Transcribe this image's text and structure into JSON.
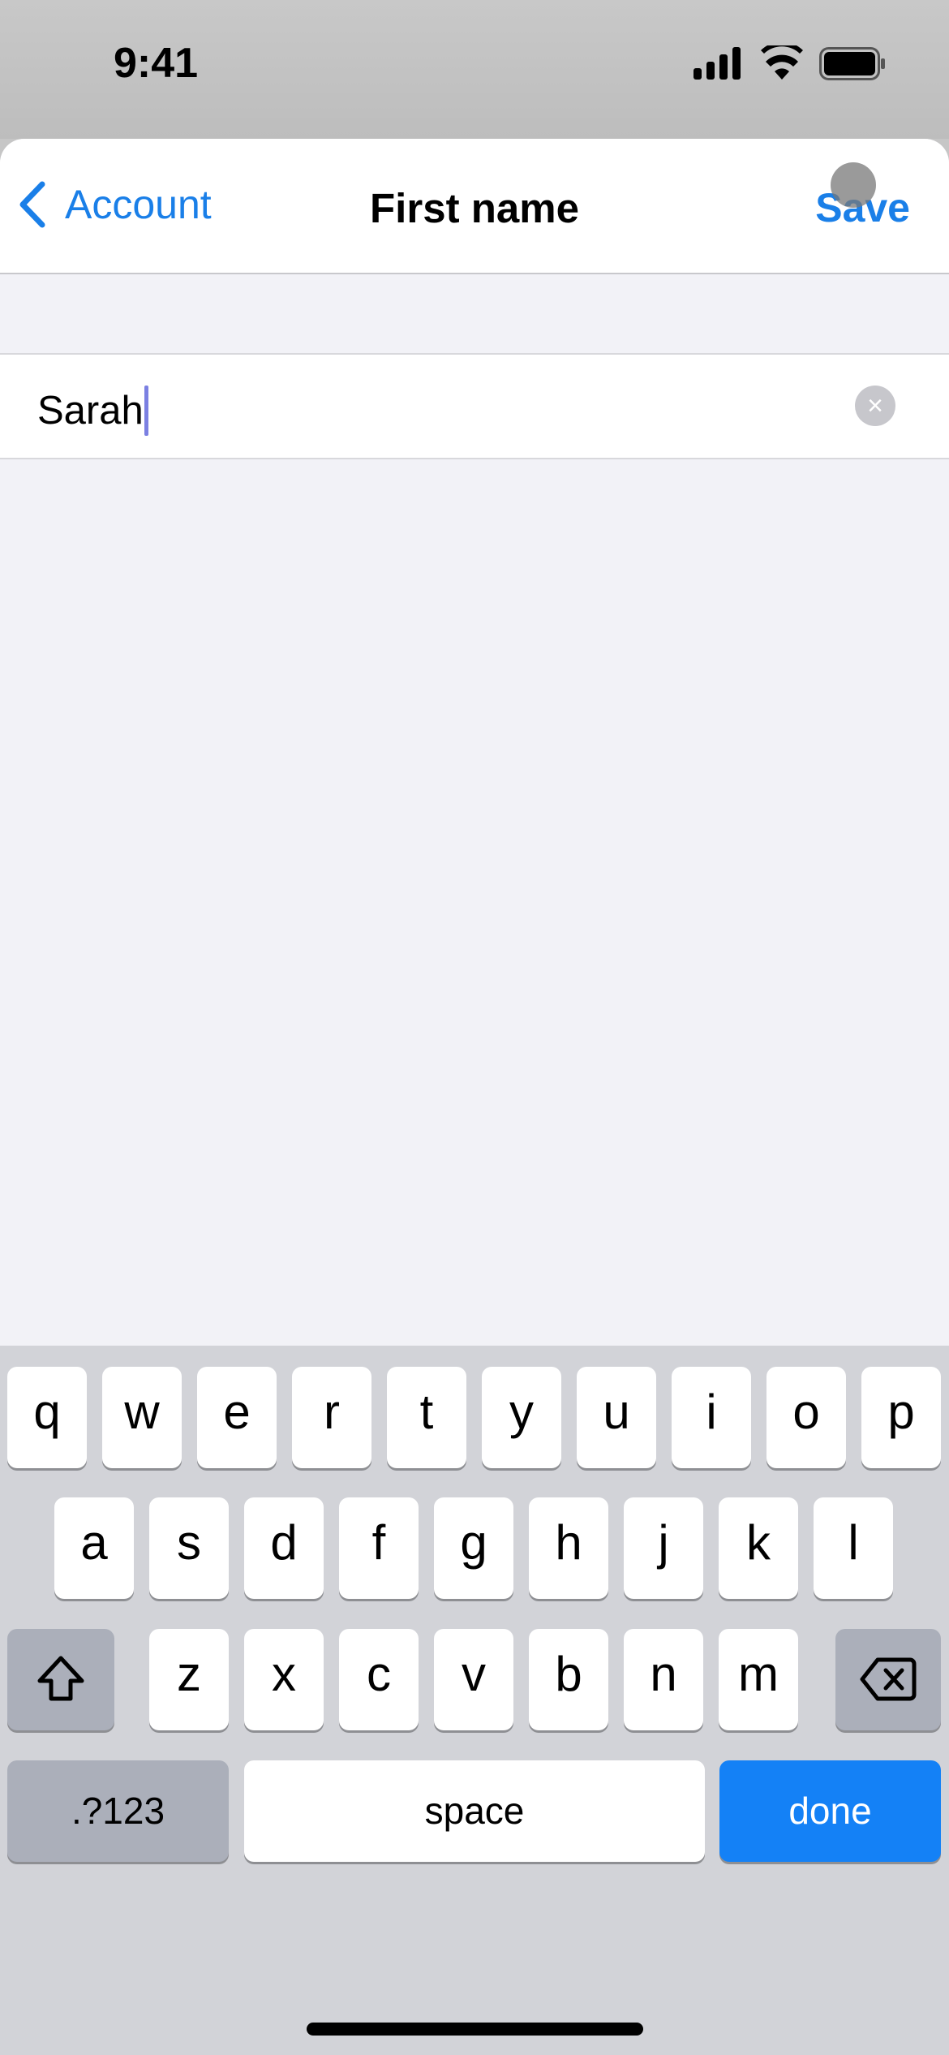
{
  "status_bar": {
    "time": "9:41",
    "icons": [
      "cellular-signal-icon",
      "wifi-icon",
      "battery-icon"
    ]
  },
  "nav": {
    "back_label": "Account",
    "title": "First name",
    "save_label": "Save"
  },
  "field": {
    "value": "Sarah",
    "clear_icon": "clear-circle-icon"
  },
  "keyboard": {
    "row1": [
      "q",
      "w",
      "e",
      "r",
      "t",
      "y",
      "u",
      "i",
      "o",
      "p"
    ],
    "row2": [
      "a",
      "s",
      "d",
      "f",
      "g",
      "h",
      "j",
      "k",
      "l"
    ],
    "row3": [
      "z",
      "x",
      "c",
      "v",
      "b",
      "n",
      "m"
    ],
    "numbers_label": ".?123",
    "space_label": "space",
    "done_label": "done"
  },
  "colors": {
    "accent": "#1a7fe8",
    "done_key": "#1481f6",
    "background": "#f2f2f7",
    "keyboard": "#d2d3d8"
  }
}
